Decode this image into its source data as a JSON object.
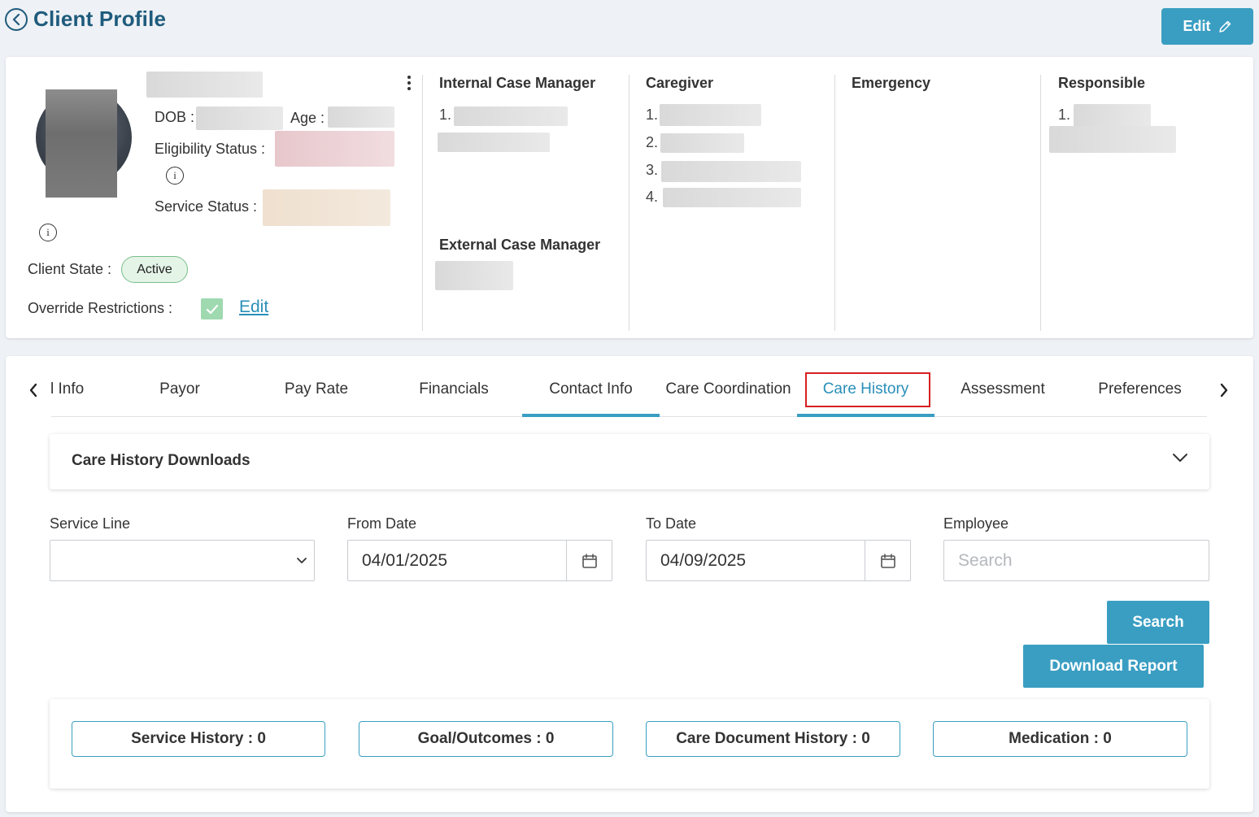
{
  "header": {
    "title": "Client Profile",
    "edit_label": "Edit"
  },
  "profile": {
    "dob_label": "DOB :",
    "age_label": "Age :",
    "eligibility_label": "Eligibility Status :",
    "service_status_label": "Service Status :",
    "client_state_label": "Client State :",
    "client_state_value": "Active",
    "override_label": "Override Restrictions :",
    "override_checked": true,
    "edit_link": "Edit"
  },
  "columns": {
    "internal_case_manager": {
      "title": "Internal Case Manager",
      "numbers": [
        "1."
      ]
    },
    "external_case_manager": {
      "title": "External Case Manager"
    },
    "caregiver": {
      "title": "Caregiver",
      "numbers": [
        "1.",
        "2.",
        "3.",
        "4."
      ]
    },
    "emergency": {
      "title": "Emergency"
    },
    "responsible": {
      "title": "Responsible",
      "numbers": [
        "1."
      ]
    }
  },
  "tabs": [
    {
      "label": "l Info"
    },
    {
      "label": "Payor"
    },
    {
      "label": "Pay Rate"
    },
    {
      "label": "Financials"
    },
    {
      "label": "Contact Info"
    },
    {
      "label": "Care Coordination"
    },
    {
      "label": "Care History"
    },
    {
      "label": "Assessment"
    },
    {
      "label": "Preferences"
    }
  ],
  "active_tab": "Care History",
  "downloads": {
    "title": "Care History Downloads"
  },
  "filters": {
    "service_line": {
      "label": "Service Line",
      "value": ""
    },
    "from_date": {
      "label": "From Date",
      "value": "04/01/2025"
    },
    "to_date": {
      "label": "To Date",
      "value": "04/09/2025"
    },
    "employee": {
      "label": "Employee",
      "placeholder": "Search",
      "value": ""
    }
  },
  "actions": {
    "search": "Search",
    "download_report": "Download Report"
  },
  "summary": [
    {
      "label": "Service History : 0"
    },
    {
      "label": "Goal/Outcomes : 0"
    },
    {
      "label": "Care Document History : 0"
    },
    {
      "label": "Medication : 0"
    }
  ],
  "colors": {
    "accent": "#3a9ec2",
    "title": "#1e5b7c",
    "active_badge_bg": "#e4f4e7",
    "highlight": "#d62020"
  }
}
